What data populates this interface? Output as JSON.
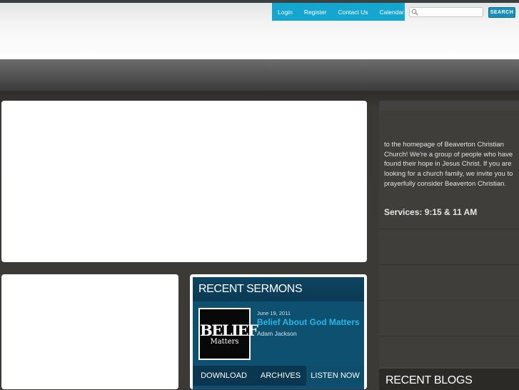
{
  "nav": {
    "items": [
      {
        "label": "Login"
      },
      {
        "label": "Register"
      },
      {
        "label": "Contact Us"
      },
      {
        "label": "Calendar"
      }
    ]
  },
  "search": {
    "placeholder": "",
    "button_label": "SEARCH",
    "icon": "search-icon"
  },
  "sidebar": {
    "welcome_text": "to the homepage of Beaverton Christian Church! We're a group of people who have found their hope in Jesus Christ.  If you are looking for a church family, we invite you to prayerfully consider Beaverton Christian.",
    "services": "Services:  9:15 & 11 AM",
    "blogs_title": "RECENT BLOGS"
  },
  "sermons": {
    "title": "RECENT SERMONS",
    "thumbnail": {
      "line1": "BELIEF",
      "line2": "Matters"
    },
    "date": "June 19, 2011",
    "sermon_title": "Belief About God Matters",
    "speaker": "Adam Jackson",
    "tabs": [
      {
        "label": "DOWNLOAD"
      },
      {
        "label": "ARCHIVES"
      },
      {
        "label": "LISTEN NOW"
      }
    ]
  },
  "colors": {
    "accent": "#14a6cf",
    "sermon_title": "#27b6e8",
    "sermon_panel": "#0d4460"
  }
}
